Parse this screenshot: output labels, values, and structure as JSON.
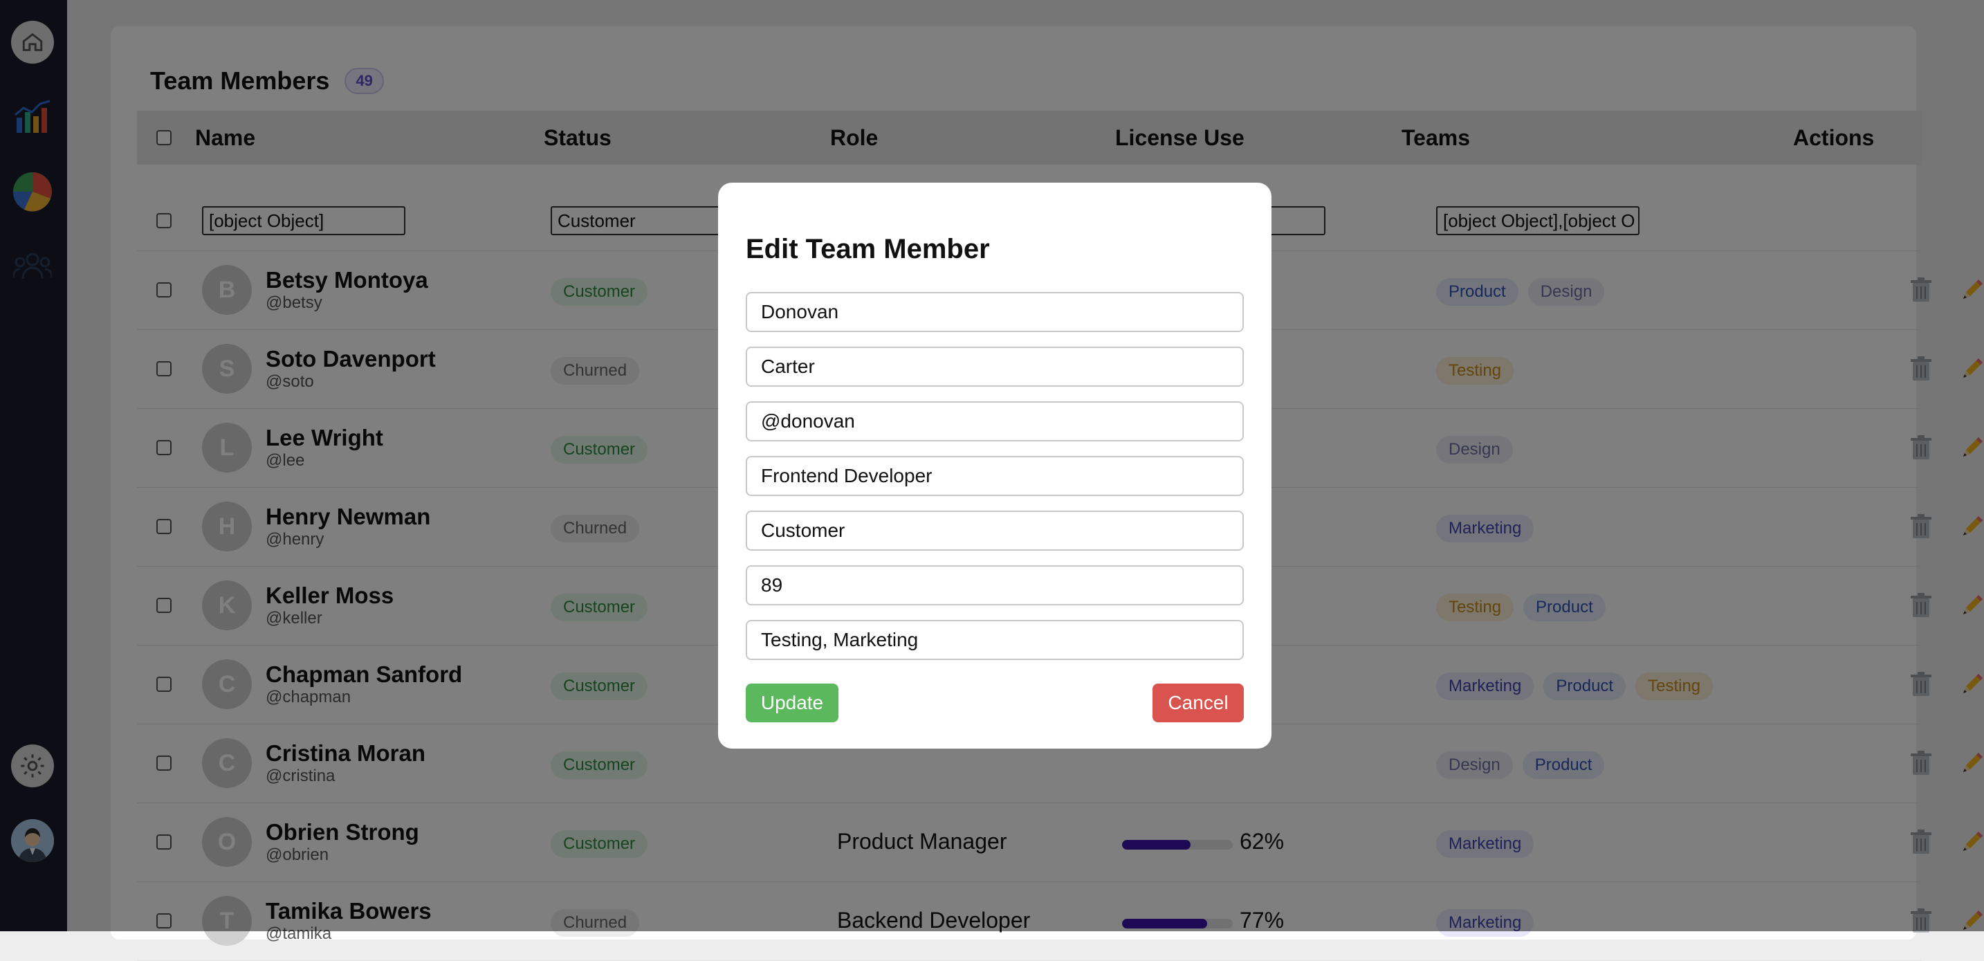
{
  "sidebar": {
    "icons": [
      "home-icon",
      "bar-chart-icon",
      "pie-chart-icon",
      "users-icon",
      "gear-icon",
      "user-avatar"
    ]
  },
  "header": {
    "title": "Team Members",
    "count": "49"
  },
  "columns": [
    "Name",
    "Status",
    "Role",
    "License Use",
    "Teams",
    "Actions"
  ],
  "filters": {
    "name": "[object Object]",
    "status": "Customer",
    "role": "",
    "license": "",
    "teams": "[object Object],[object O"
  },
  "rows": [
    {
      "initial": "B",
      "name": "Betsy Montoya",
      "handle": "@betsy",
      "status": "Customer",
      "role": "",
      "license": "",
      "license_pct": null,
      "teams": [
        "Product",
        "Design"
      ]
    },
    {
      "initial": "S",
      "name": "Soto Davenport",
      "handle": "@soto",
      "status": "Churned",
      "role": "",
      "license": "",
      "license_pct": null,
      "teams": [
        "Testing"
      ]
    },
    {
      "initial": "L",
      "name": "Lee Wright",
      "handle": "@lee",
      "status": "Customer",
      "role": "",
      "license": "",
      "license_pct": null,
      "teams": [
        "Design"
      ]
    },
    {
      "initial": "H",
      "name": "Henry Newman",
      "handle": "@henry",
      "status": "Churned",
      "role": "",
      "license": "",
      "license_pct": null,
      "teams": [
        "Marketing"
      ]
    },
    {
      "initial": "K",
      "name": "Keller Moss",
      "handle": "@keller",
      "status": "Customer",
      "role": "",
      "license": "",
      "license_pct": null,
      "teams": [
        "Testing",
        "Product"
      ]
    },
    {
      "initial": "C",
      "name": "Chapman Sanford",
      "handle": "@chapman",
      "status": "Customer",
      "role": "",
      "license": "",
      "license_pct": null,
      "teams": [
        "Marketing",
        "Product",
        "Testing"
      ]
    },
    {
      "initial": "C",
      "name": "Cristina Moran",
      "handle": "@cristina",
      "status": "Customer",
      "role": "",
      "license": "",
      "license_pct": null,
      "teams": [
        "Design",
        "Product"
      ]
    },
    {
      "initial": "O",
      "name": "Obrien Strong",
      "handle": "@obrien",
      "status": "Customer",
      "role": "Product Manager",
      "license": "62%",
      "license_pct": 62,
      "teams": [
        "Marketing"
      ]
    },
    {
      "initial": "T",
      "name": "Tamika Bowers",
      "handle": "@tamika",
      "status": "Churned",
      "role": "Backend Developer",
      "license": "77%",
      "license_pct": 77,
      "teams": [
        "Marketing"
      ]
    }
  ],
  "modal": {
    "title": "Edit Team Member",
    "fields": [
      "Donovan",
      "Carter",
      "@donovan",
      "Frontend Developer",
      "Customer",
      "89",
      "Testing, Marketing"
    ],
    "update_label": "Update",
    "cancel_label": "Cancel"
  },
  "colors": {
    "sidebar_bg": "#1a1d2b",
    "license_bar": "#3c12a8",
    "update_button": "#5cb85c",
    "cancel_button": "#d9534f"
  }
}
